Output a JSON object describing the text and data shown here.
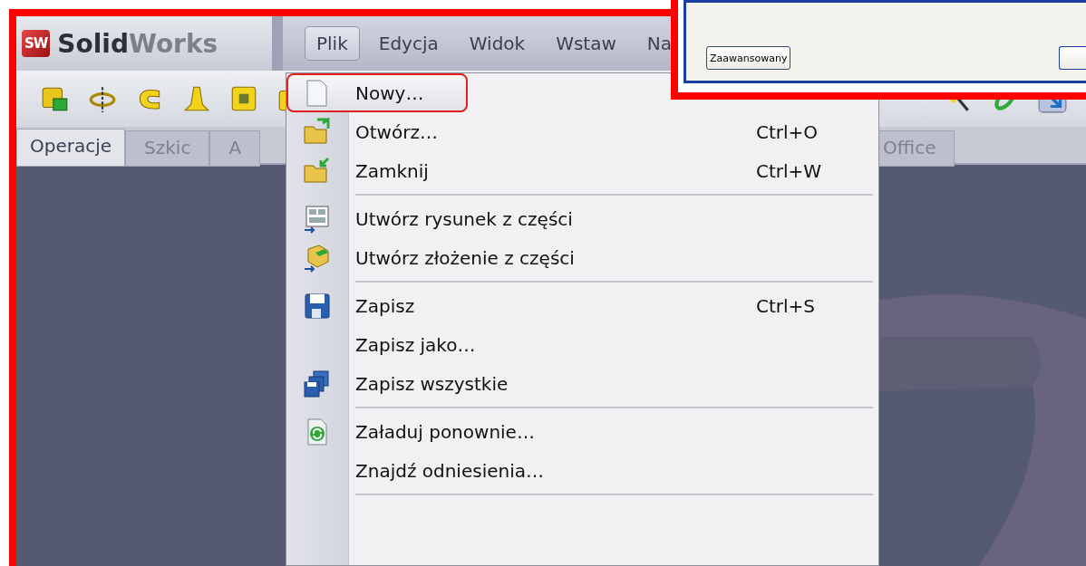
{
  "app": {
    "logo_badge": "SW",
    "brand": "**Solid**Works"
  },
  "menubar": [
    {
      "label": "Plik",
      "selected": true
    },
    {
      "label": "Edycja",
      "selected": false
    },
    {
      "label": "Widok",
      "selected": false
    },
    {
      "label": "Wstaw",
      "selected": false
    },
    {
      "label": "Na",
      "selected": false
    }
  ],
  "tabs": [
    {
      "label": "Operacje",
      "selected": true
    },
    {
      "label": "Szkic",
      "selected": false
    },
    {
      "label": "A",
      "selected": false
    },
    {
      "label": "Office",
      "selected": false
    }
  ],
  "file_menu": {
    "groups": [
      {
        "items": [
          {
            "label": "Nowy…",
            "highlighted": true
          },
          {
            "label": "Otwórz…",
            "shortcut": "Ctrl+O",
            "highlighted": false
          },
          {
            "label": "Zamknij",
            "shortcut": "Ctrl+W",
            "highlighted": false
          }
        ]
      },
      {
        "items": [
          {
            "label": "Utwórz rysunek z części",
            "highlighted": false
          },
          {
            "label": "Utwórz złożenie z części",
            "highlighted": false
          }
        ]
      },
      {
        "items": [
          {
            "label": "Zapisz",
            "shortcut": "Ctrl+S",
            "highlighted": false
          },
          {
            "label": "Zapisz jako…",
            "highlighted": false
          },
          {
            "label": "Zapisz wszystkie",
            "highlighted": false
          }
        ]
      },
      {
        "items": [
          {
            "label": "Załaduj ponownie…",
            "highlighted": false
          },
          {
            "label": "Znajdź odniesienia…",
            "highlighted": false
          }
        ]
      }
    ]
  },
  "dialog": {
    "buttons": [
      {
        "label": "Zaawansowany"
      }
    ]
  }
}
